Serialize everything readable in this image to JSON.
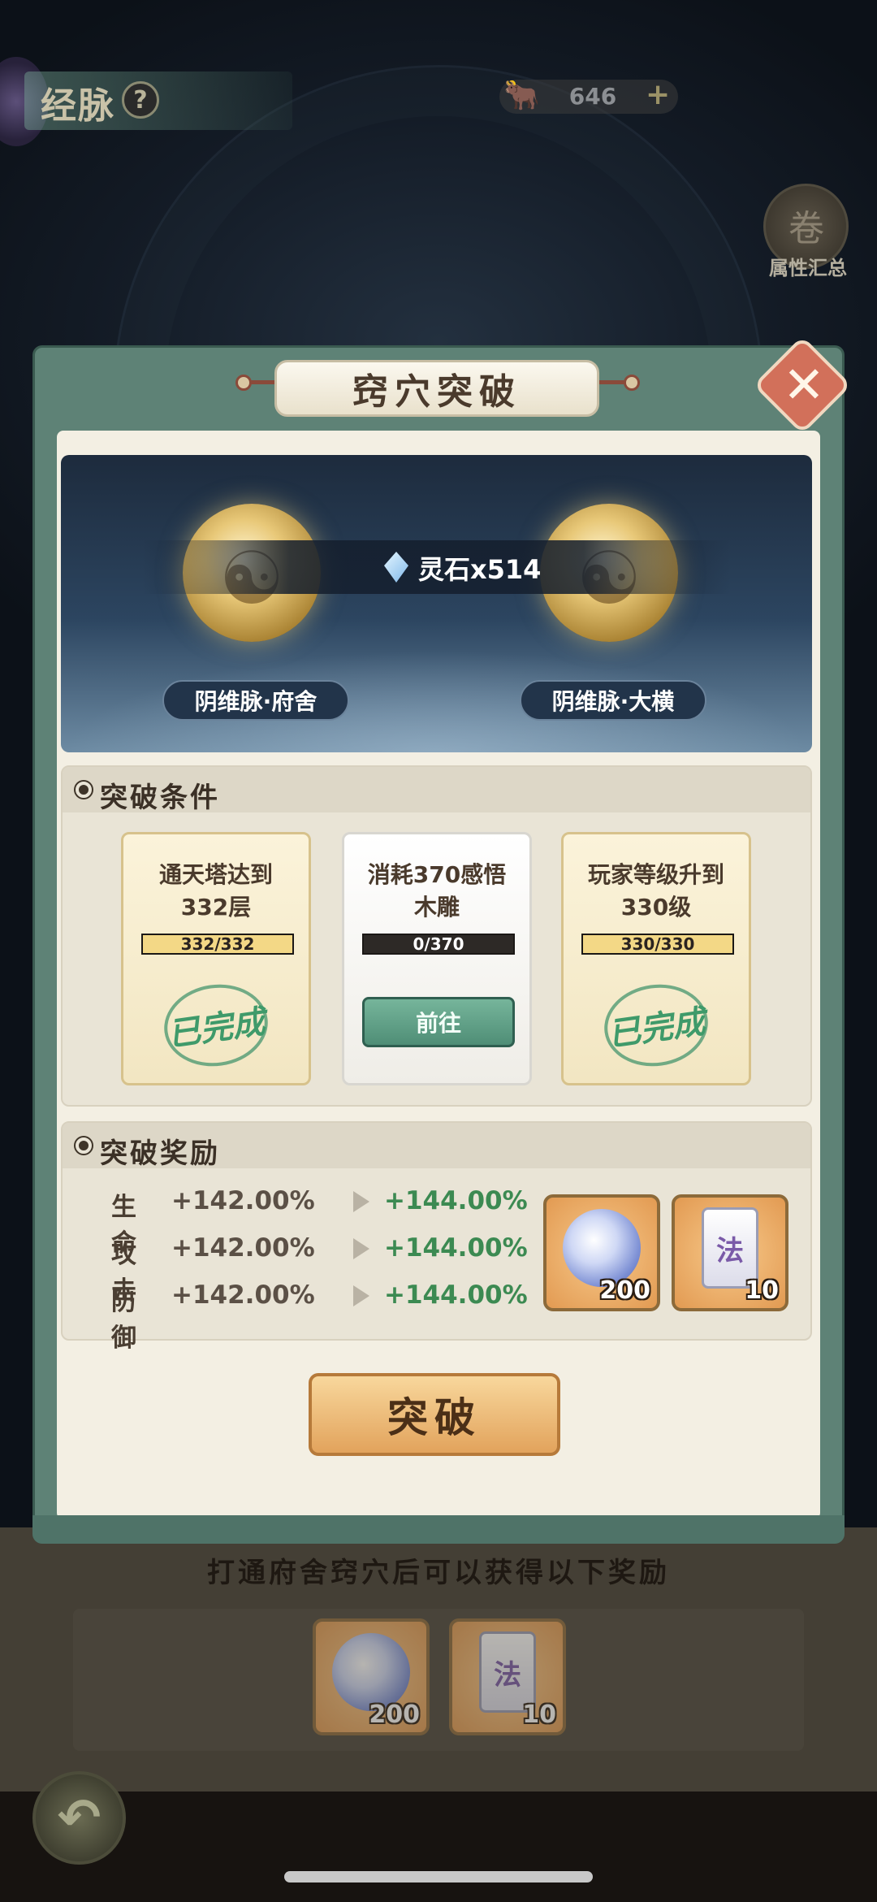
{
  "top_bar": {
    "title": "经脉",
    "help_icon": "?",
    "resource_value": "646",
    "resource_plus": "+",
    "attr_summary_label": "属性汇总"
  },
  "dialog": {
    "title": "窍穴突破",
    "close_icon": "✕",
    "hero": {
      "cost_text": "灵石x514",
      "from_node": "阴维脉·府舍",
      "to_node": "阴维脉·大横"
    },
    "conditions": {
      "title": "突破条件",
      "cards": [
        {
          "line1": "通天塔达到",
          "line2": "332层",
          "progress_text": "332/332",
          "progress": 1.0,
          "status": "已完成"
        },
        {
          "line1": "消耗370感悟",
          "line2": "木雕",
          "progress_text": "0/370",
          "progress": 0.0,
          "action": "前往"
        },
        {
          "line1": "玩家等级升到",
          "line2": "330级",
          "progress_text": "330/330",
          "progress": 1.0,
          "status": "已完成"
        }
      ]
    },
    "rewards": {
      "title": "突破奖励",
      "stats": [
        {
          "name": "生命",
          "old": "+142.00%",
          "new": "+144.00%"
        },
        {
          "name": "攻击",
          "old": "+142.00%",
          "new": "+144.00%"
        },
        {
          "name": "防御",
          "old": "+142.00%",
          "new": "+144.00%"
        }
      ],
      "items": [
        {
          "icon": "spirit-gem-icon",
          "count": "200"
        },
        {
          "icon": "law-scroll-icon",
          "glyph": "法",
          "count": "10"
        }
      ]
    },
    "break_button": "突破"
  },
  "lower": {
    "hint": "打通府舍窍穴后可以获得以下奖励",
    "items": [
      {
        "icon": "spirit-gem-icon",
        "count": "200"
      },
      {
        "icon": "law-scroll-icon",
        "glyph": "法",
        "count": "10"
      }
    ]
  },
  "colors": {
    "frame": "#5e8276",
    "paper": "#f3efe3",
    "increase_green": "#3c8a52",
    "button_orange": "#e2a35c"
  }
}
